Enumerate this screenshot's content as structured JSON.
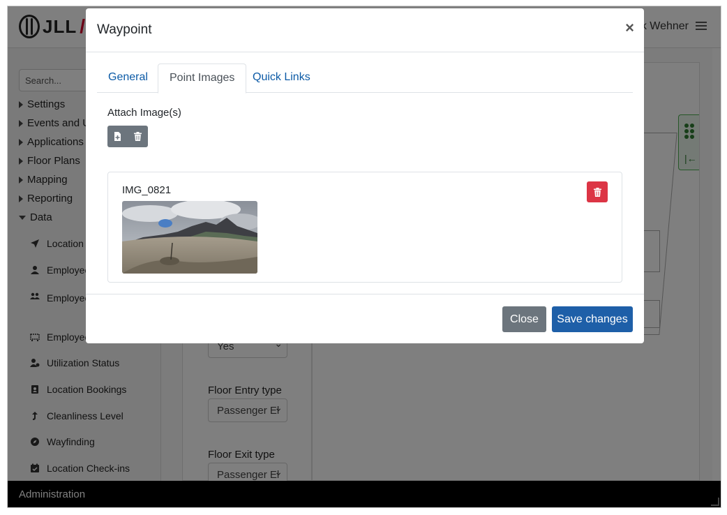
{
  "app": {
    "logo_text": "JLL",
    "user_name": "k Wehner",
    "search_placeholder": "Search...",
    "nav": [
      {
        "label": "Settings",
        "expanded": false
      },
      {
        "label": "Events and U",
        "expanded": false
      },
      {
        "label": "Applications",
        "expanded": false
      },
      {
        "label": "Floor Plans",
        "expanded": false
      },
      {
        "label": "Mapping",
        "expanded": false
      },
      {
        "label": "Reporting",
        "expanded": false
      },
      {
        "label": "Data",
        "expanded": true
      }
    ],
    "data_items": [
      {
        "label": "Location",
        "icon": "location-arrow-icon"
      },
      {
        "label": "Employee",
        "icon": "user-icon"
      },
      {
        "label": "Employee Levels",
        "icon": "users-icon"
      },
      {
        "label": "Employee",
        "icon": "desk-icon"
      },
      {
        "label": "Utilization Status",
        "icon": "user-status-icon"
      },
      {
        "label": "Location Bookings",
        "icon": "booking-icon"
      },
      {
        "label": "Cleanliness Level",
        "icon": "arrow-up-icon"
      },
      {
        "label": "Wayfinding",
        "icon": "compass-icon"
      },
      {
        "label": "Location Check-ins",
        "icon": "calendar-check-icon"
      }
    ],
    "form": {
      "yes_value": "Yes",
      "entry_label": "Floor Entry type",
      "entry_value": "Passenger El",
      "exit_label": "Floor Exit type",
      "exit_value": "Passenger El"
    },
    "footer_text": "Administration"
  },
  "modal": {
    "title": "Waypoint",
    "close_glyph": "×",
    "tabs": [
      {
        "label": "General",
        "active": false
      },
      {
        "label": "Point Images",
        "active": true
      },
      {
        "label": "Quick Links",
        "active": false
      }
    ],
    "attach_label": "Attach Image(s)",
    "images": [
      {
        "name": "IMG_0821"
      }
    ],
    "footer": {
      "close_label": "Close",
      "save_label": "Save changes"
    }
  },
  "colors": {
    "primary": "#1e5fa8",
    "secondary": "#6c757d",
    "danger": "#dc3545",
    "tab_link": "#0b5aa6",
    "accent_green": "#4caf50"
  }
}
